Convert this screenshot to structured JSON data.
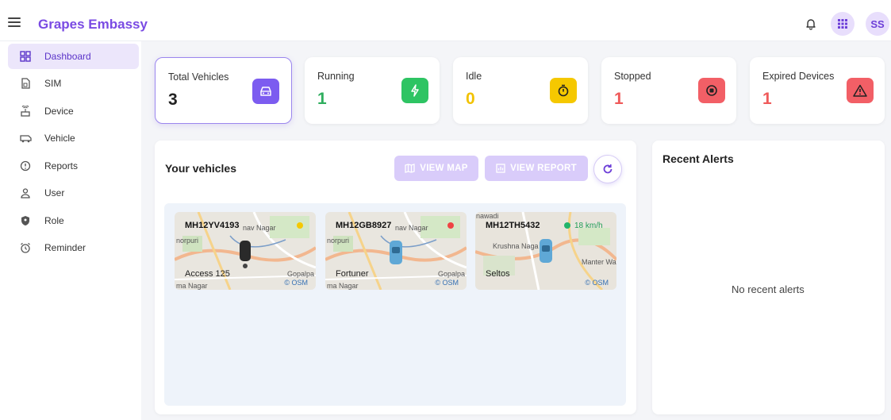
{
  "header": {
    "app_title": "Grapes Embassy",
    "avatar_initials": "SS",
    "icons": [
      "menu-icon",
      "bell-icon",
      "apps-grid-icon"
    ]
  },
  "sidebar": {
    "items": [
      {
        "label": "Dashboard",
        "icon": "dashboard-icon",
        "active": true
      },
      {
        "label": "SIM",
        "icon": "sim-icon"
      },
      {
        "label": "Device",
        "icon": "device-icon"
      },
      {
        "label": "Vehicle",
        "icon": "vehicle-icon"
      },
      {
        "label": "Reports",
        "icon": "reports-icon"
      },
      {
        "label": "User",
        "icon": "user-icon"
      },
      {
        "label": "Role",
        "icon": "role-icon"
      },
      {
        "label": "Reminder",
        "icon": "reminder-icon"
      }
    ]
  },
  "stats": [
    {
      "label": "Total Vehicles",
      "value": "3",
      "color": "#222222",
      "badge_color": "#7c5cf0",
      "icon": "car-icon"
    },
    {
      "label": "Running",
      "value": "1",
      "color": "#2fae5e",
      "badge_color": "#2ec463",
      "icon": "bolt-icon"
    },
    {
      "label": "Idle",
      "value": "0",
      "color": "#f2c200",
      "badge_color": "#f5c800",
      "icon": "timer-icon"
    },
    {
      "label": "Stopped",
      "value": "1",
      "color": "#ef5a5a",
      "badge_color": "#f25f66",
      "icon": "stop-icon"
    },
    {
      "label": "Expired Devices",
      "value": "1",
      "color": "#ef5a5a",
      "badge_color": "#f25f66",
      "icon": "warning-icon"
    }
  ],
  "vehicles_panel": {
    "title": "Your vehicles",
    "view_map_label": "VIEW MAP",
    "view_report_label": "VIEW REPORT",
    "vehicles": [
      {
        "plate": "MH12YV4193",
        "model": "Access 125",
        "status_color": "#f5c800",
        "speed": "",
        "map_labels": [
          "nav Nagar",
          "norpuri",
          "Gopalpa",
          "ma Nagar"
        ]
      },
      {
        "plate": "MH12GB8927",
        "model": "Fortuner",
        "status_color": "#ef4444",
        "speed": "",
        "map_labels": [
          "nav Nagar",
          "norpuri",
          "Gopalpa",
          "ma Nagar"
        ]
      },
      {
        "plate": "MH12TH5432",
        "model": "Seltos",
        "status_color": "#22b46a",
        "speed": "18 km/h",
        "map_labels": [
          "nawadi",
          "Krushna Naga",
          "Manter Wa"
        ]
      }
    ],
    "osm_label": "© OSM"
  },
  "alerts_panel": {
    "title": "Recent Alerts",
    "empty_text": "No recent alerts"
  }
}
